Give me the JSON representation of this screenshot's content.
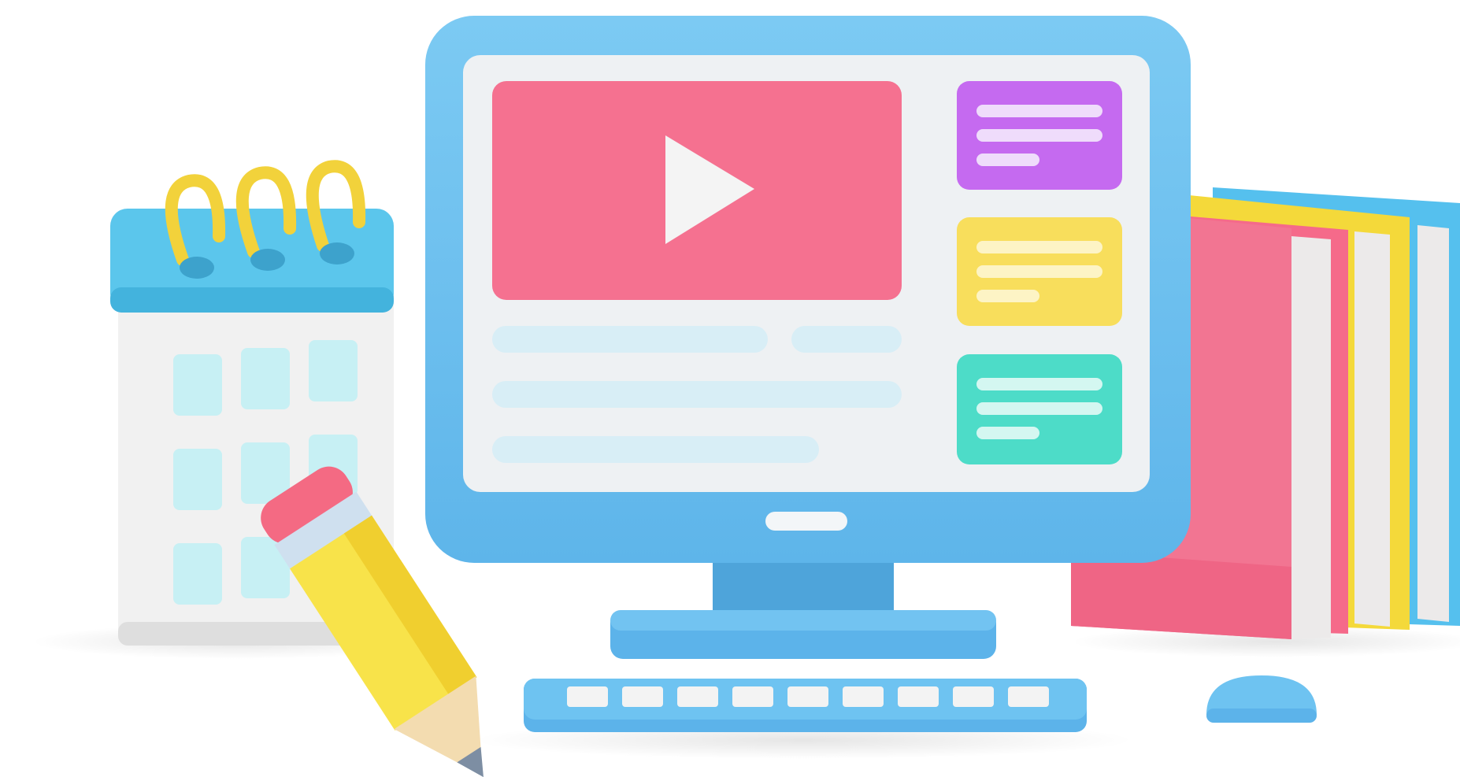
{
  "scene": {
    "description_free": true,
    "colors": {
      "background": "#ffffff",
      "monitor_frame": "#6ec3f1",
      "monitor_frame_dark": "#4ea4da",
      "screen": "#eef1f3",
      "video_panel": "#f57190",
      "play_icon": "#f4f4f4",
      "card_purple": "#c56af0",
      "card_yellow": "#f8de5c",
      "card_teal": "#4ddcc8",
      "text_line": "#d8eef6",
      "calendar_header": "#5bc6ec",
      "calendar_body": "#f1f1f1",
      "calendar_cell": "#c7f0f4",
      "calendar_ring": "#f2d23b",
      "pencil_body": "#f8e34a",
      "pencil_eraser": "#f46a83",
      "pencil_band": "#cfe0ef",
      "pencil_tip": "#f3dcb0",
      "book_pink": "#f56a8a",
      "book_yellow": "#f4d93a",
      "book_blue": "#55c0ee",
      "book_pages": "#eceaea",
      "keyboard": "#6ec3f1",
      "keyboard_keys": "#f3f3f3",
      "mouse": "#6ec3f1"
    },
    "icons": [
      "play-icon",
      "calendar-icon",
      "pencil-icon",
      "books-icon",
      "keyboard-icon",
      "mouse-icon",
      "monitor-icon"
    ]
  }
}
